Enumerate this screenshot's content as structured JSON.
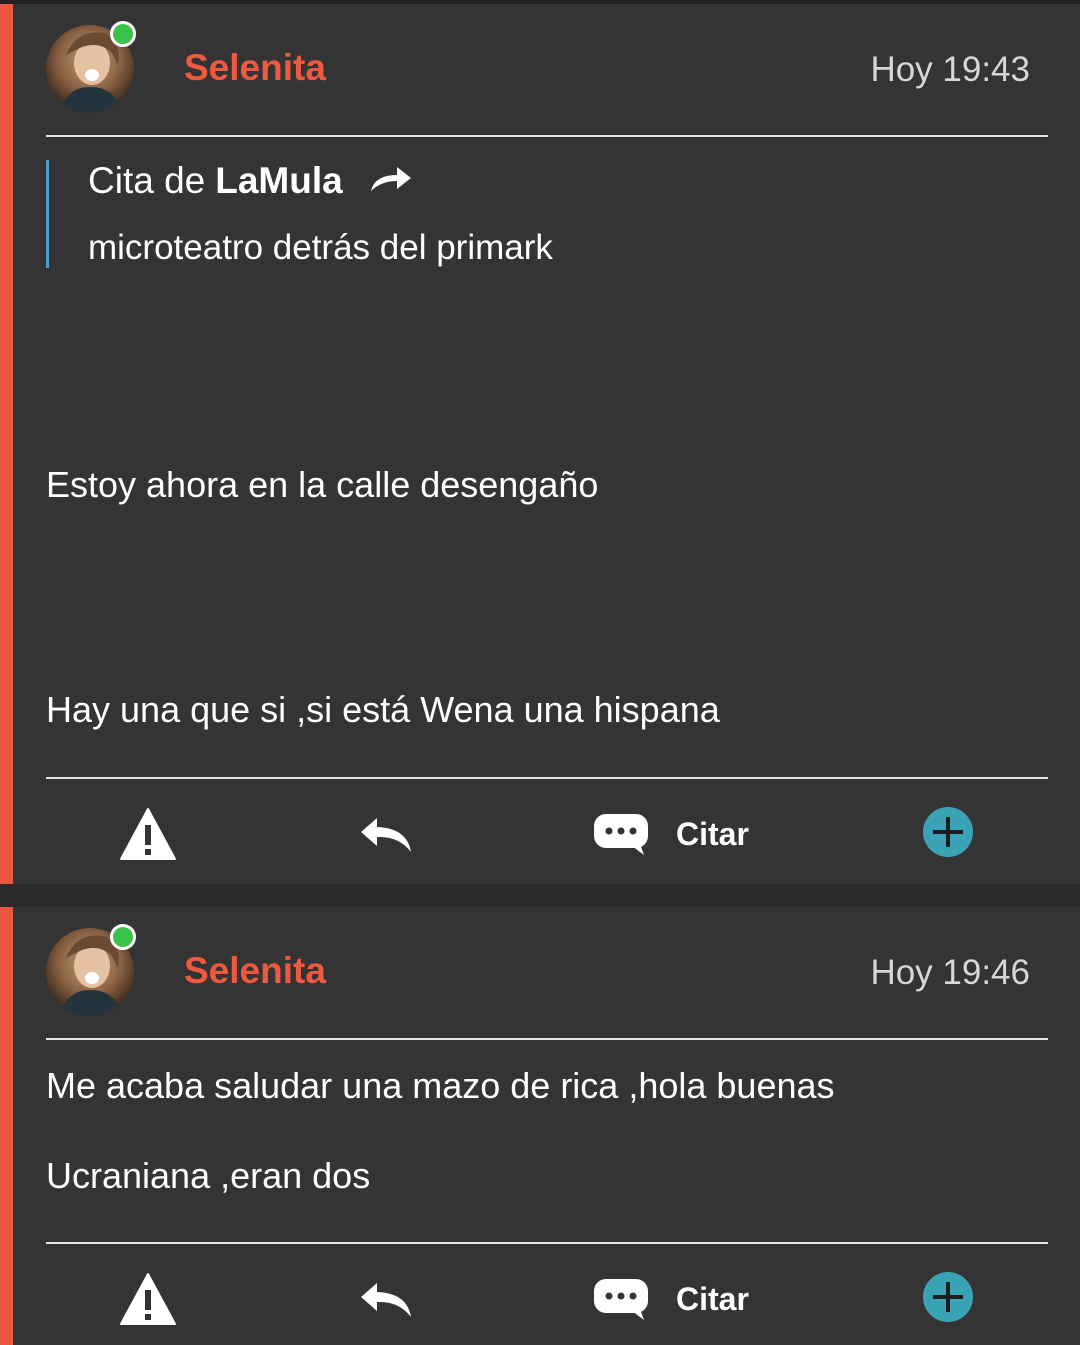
{
  "posts": [
    {
      "username": "Selenita",
      "time": "Hoy 19:43",
      "online": true,
      "quote": {
        "prefix": "Cita de",
        "author": "LaMula",
        "text": "microteatro detrás del primark"
      },
      "lines": [
        "Estoy ahora en la calle desengaño",
        "Hay una que si ,si está Wena una hispana"
      ],
      "actions": {
        "report_icon": "warning-icon",
        "reply_icon": "reply-icon",
        "quote_icon": "speech-bubble-icon",
        "quote_label": "Citar",
        "more_icon": "plus-circle-icon"
      }
    },
    {
      "username": "Selenita",
      "time": "Hoy 19:46",
      "online": true,
      "lines": [
        "Me acaba saludar una mazo de rica ,hola buenas",
        "Ucraniana ,eran dos"
      ],
      "actions": {
        "report_icon": "warning-icon",
        "reply_icon": "reply-icon",
        "quote_icon": "speech-bubble-icon",
        "quote_label": "Citar",
        "more_icon": "plus-circle-icon"
      }
    }
  ],
  "colors": {
    "accent": "#e9573f",
    "username": "#ee5a40",
    "online": "#3bc24a",
    "plus": "#3aa3b5",
    "quote_bar": "#4aa3c4"
  }
}
